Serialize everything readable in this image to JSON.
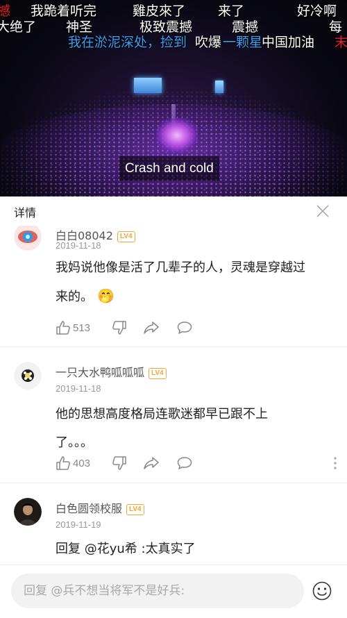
{
  "video": {
    "subtitle": "Crash and cold",
    "danmaku": [
      {
        "text": "撼",
        "color": "red"
      },
      {
        "text": "我跪着听完",
        "color": "white"
      },
      {
        "text": "雞皮來了",
        "color": "white"
      },
      {
        "text": "来了",
        "color": "white"
      },
      {
        "text": "好冷啊",
        "color": "white"
      },
      {
        "text": "大绝了",
        "color": "white"
      },
      {
        "text": "神圣",
        "color": "white"
      },
      {
        "text": "极致震撼",
        "color": "white"
      },
      {
        "text": "震撼",
        "color": "white"
      },
      {
        "text": "每",
        "color": "white"
      },
      {
        "text": "我在淤泥深处，捡到",
        "color": "blue"
      },
      {
        "text": "吹爆",
        "color": "white"
      },
      {
        "text": "一颗星",
        "color": "blue"
      },
      {
        "text": "中国加油",
        "color": "white"
      },
      {
        "text": "末",
        "color": "red"
      }
    ]
  },
  "panel": {
    "title": "详情"
  },
  "comments": [
    {
      "username": "白白08042",
      "level": "LV4",
      "date": "2019-11-18",
      "lines": [
        "我妈说他像是活了几辈子的人，灵魂是穿越过",
        "来的。"
      ],
      "emoji": "🤭",
      "likes": "513"
    },
    {
      "username": "一只大水鸭呱呱呱",
      "level": "LV4",
      "date": "2019-11-18",
      "lines": [
        "他的思想高度格局连歌迷都早已跟不上",
        "了。。。"
      ],
      "likes": "403"
    },
    {
      "username": "白色圆领校服",
      "level": "LV4",
      "date": "2019-11-19",
      "lines": [
        "回复 @花yu希 :太真实了"
      ]
    }
  ],
  "reply": {
    "placeholder": "回复 @兵不想当将军不是好兵:"
  },
  "colors": {
    "level_badge": "#f2a53a",
    "danmaku_red": "#e8202a",
    "danmaku_blue": "#3a9ff0"
  },
  "icons": [
    "close-icon",
    "thumbs-up-icon",
    "thumbs-down-icon",
    "share-icon",
    "comment-icon",
    "more-icon",
    "smiley-icon"
  ]
}
